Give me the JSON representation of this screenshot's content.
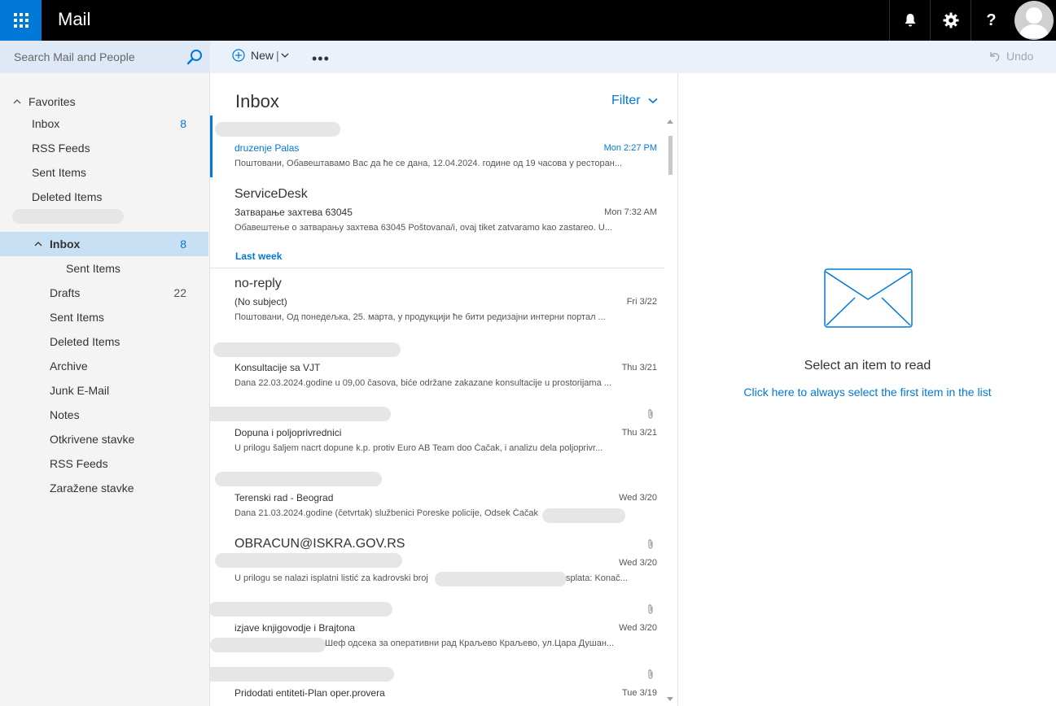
{
  "header": {
    "app_title": "Mail",
    "icons": [
      "waffle-icon",
      "bell-icon",
      "gear-icon",
      "help-icon",
      "avatar"
    ]
  },
  "search": {
    "placeholder": "Search Mail and People"
  },
  "commands": {
    "new_label": "New",
    "separator": "|",
    "more": "•••",
    "undo_label": "Undo"
  },
  "favorites": {
    "label": "Favorites",
    "items": [
      {
        "label": "Inbox",
        "count": "8"
      },
      {
        "label": "RSS Feeds",
        "count": ""
      },
      {
        "label": "Sent Items",
        "count": ""
      },
      {
        "label": "Deleted Items",
        "count": ""
      }
    ]
  },
  "folders": {
    "inbox": {
      "label": "Inbox",
      "count": "8"
    },
    "items": [
      {
        "label": "Sent Items",
        "count": ""
      },
      {
        "label": "Drafts",
        "count": "22"
      },
      {
        "label": "Sent Items",
        "count": ""
      },
      {
        "label": "Deleted Items",
        "count": ""
      },
      {
        "label": "Archive",
        "count": ""
      },
      {
        "label": "Junk E-Mail",
        "count": ""
      },
      {
        "label": "Notes",
        "count": ""
      },
      {
        "label": "Otkrivene stavke",
        "count": ""
      },
      {
        "label": "RSS Feeds",
        "count": ""
      },
      {
        "label": "Zaražene stavke",
        "count": ""
      }
    ]
  },
  "list": {
    "title": "Inbox",
    "filter_label": "Filter",
    "group_last_week": "Last week",
    "messages": [
      {
        "sender": "",
        "subject": "druzenje Palas",
        "time": "Mon 2:27 PM",
        "preview": "Поштовани, Обавештавамо Вас да ће се дана, 12.04.2024. године од 19 часова у ресторан...",
        "attachment": false,
        "selected": true
      },
      {
        "sender": "ServiceDesk",
        "subject": "Затварање захтева 63045",
        "time": "Mon 7:32 AM",
        "preview": "Обавештење о затварању захтева 63045 Poštovana/i, ovaj tiket zatvaramo kao zastareo. U...",
        "attachment": false,
        "selected": false
      },
      {
        "sender": "no-reply",
        "subject": "(No subject)",
        "time": "Fri 3/22",
        "preview": "Поштовани, Од понедељка, 25. марта, у продукцији ће бити редизајни интерни портал ...",
        "attachment": false,
        "selected": false
      },
      {
        "sender": "",
        "subject": "Konsultacije sa VJT",
        "time": "Thu 3/21",
        "preview": "Dana 22.03.2024.godine u 09,00 časova, biće održane zakazane konsultacije u prostorijama ...",
        "attachment": false,
        "selected": false
      },
      {
        "sender": "",
        "subject": "Dopuna i poljoprivrednici",
        "time": "Thu 3/21",
        "preview": "U prilogu šaljem nacrt dopune k.p. protiv Euro AB Team doo Čačak, i analizu dela poljoprivr...",
        "attachment": true,
        "selected": false
      },
      {
        "sender": "",
        "subject": "Terenski rad - Beograd",
        "time": "Wed 3/20",
        "preview": "Dana 21.03.2024.godine (četvrtak) službenici Poreske policije, Odsek Čačak",
        "attachment": false,
        "selected": false
      },
      {
        "sender": "OBRACUN@ISKRA.GOV.RS",
        "subject": "",
        "time": "Wed 3/20",
        "preview": "U prilogu se nalazi isplatni listić za kadrovski broj",
        "preview_tail": "splata: Konač...",
        "attachment": true,
        "selected": false
      },
      {
        "sender": "",
        "subject": "izjave knjigovodje i Brajtona",
        "time": "Wed 3/20",
        "preview": "Шеф одсека за оперативни рад Краљево Краљево, ул.Цара Душан...",
        "attachment": true,
        "selected": false
      },
      {
        "sender": "",
        "subject": "Pridodati entiteti-Plan oper.provera",
        "time": "Tue 3/19",
        "preview": "",
        "attachment": true,
        "selected": false
      }
    ]
  },
  "reading": {
    "title": "Select an item to read",
    "link": "Click here to always select the first item in the list"
  },
  "colors": {
    "accent": "#0078d7",
    "topbar": "#000000",
    "search_bg": "#dfe9f5",
    "selected_bg": "#c7e0f4"
  }
}
